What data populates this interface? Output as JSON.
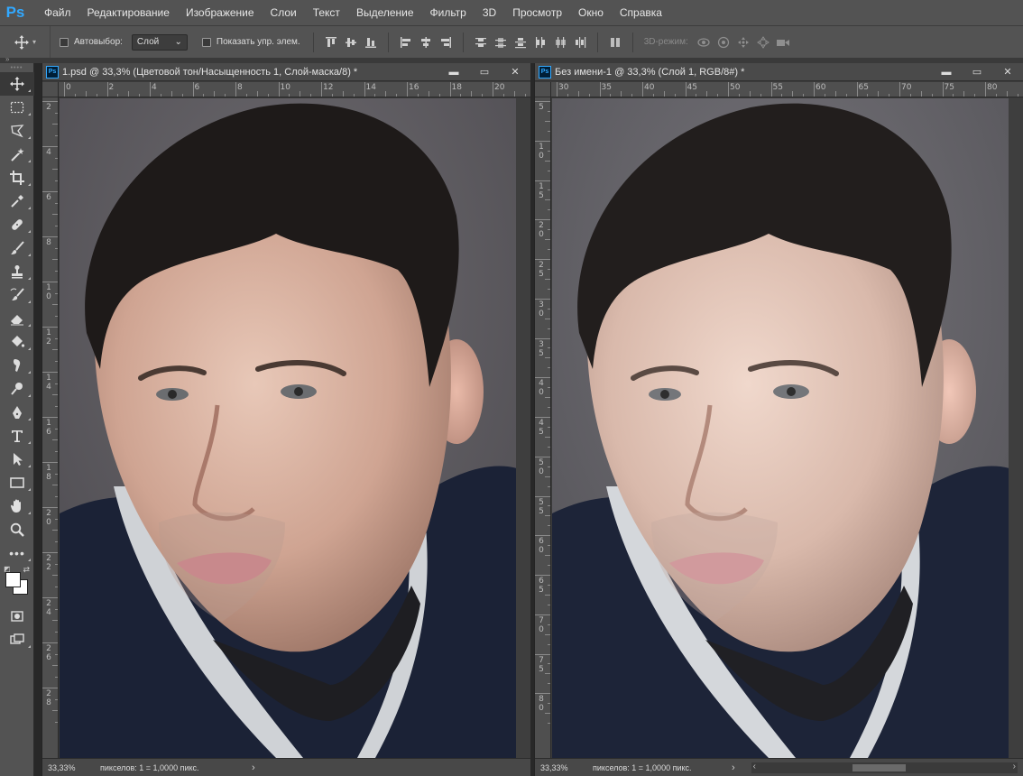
{
  "app": {
    "logo": "Ps",
    "menu": [
      "Файл",
      "Редактирование",
      "Изображение",
      "Слои",
      "Текст",
      "Выделение",
      "Фильтр",
      "3D",
      "Просмотр",
      "Окно",
      "Справка"
    ]
  },
  "options": {
    "autoselect_label": "Автовыбор:",
    "autoselect_value": "Слой",
    "show_controls_label": "Показать упр. элем.",
    "mode3d_label": "3D-режим:"
  },
  "tools": [
    {
      "name": "move-tool",
      "icon": "move-icon"
    },
    {
      "name": "marquee-tool",
      "icon": "marquee-icon"
    },
    {
      "name": "lasso-tool",
      "icon": "lasso-icon"
    },
    {
      "name": "magic-wand-tool",
      "icon": "magic-wand-icon"
    },
    {
      "name": "crop-tool",
      "icon": "crop-icon"
    },
    {
      "name": "eyedropper-tool",
      "icon": "eyedropper-icon"
    },
    {
      "name": "healing-brush-tool",
      "icon": "bandage-icon"
    },
    {
      "name": "brush-tool",
      "icon": "brush-icon"
    },
    {
      "name": "clone-stamp-tool",
      "icon": "stamp-icon"
    },
    {
      "name": "history-brush-tool",
      "icon": "history-brush-icon"
    },
    {
      "name": "eraser-tool",
      "icon": "eraser-icon"
    },
    {
      "name": "paint-bucket-tool",
      "icon": "bucket-icon"
    },
    {
      "name": "smudge-tool",
      "icon": "smudge-icon"
    },
    {
      "name": "dodge-tool",
      "icon": "dodge-icon"
    },
    {
      "name": "pen-tool",
      "icon": "pen-icon"
    },
    {
      "name": "type-tool",
      "icon": "type-icon"
    },
    {
      "name": "path-selection-tool",
      "icon": "arrow-icon"
    },
    {
      "name": "rectangle-tool",
      "icon": "rectangle-icon"
    },
    {
      "name": "hand-tool",
      "icon": "hand-icon"
    },
    {
      "name": "zoom-tool",
      "icon": "zoom-icon"
    },
    {
      "name": "more-tools",
      "icon": "ellipsis-icon"
    }
  ],
  "documents": {
    "left": {
      "title": "1.psd @ 33,3% (Цветовой тон/Насыщенность 1, Слой-маска/8) *",
      "ruler_top": [
        "0",
        "2",
        "4",
        "6",
        "8",
        "10",
        "12",
        "14",
        "16",
        "18",
        "20"
      ],
      "ruler_left": [
        "2",
        "4",
        "6",
        "8",
        "10",
        "12",
        "14",
        "16",
        "18",
        "20",
        "22",
        "24",
        "26",
        "28"
      ],
      "zoom": "33,33%",
      "info": "пикселов: 1 = 1,0000 пикс.",
      "adjusted": true
    },
    "right": {
      "title": "Без имени-1 @ 33,3% (Слой 1, RGB/8#) *",
      "ruler_top": [
        "30",
        "35",
        "40",
        "45",
        "50",
        "55",
        "60",
        "65",
        "70",
        "75",
        "80"
      ],
      "ruler_left": [
        "5",
        "1 0",
        "1 5",
        "2 0",
        "2 5",
        "3 0",
        "3 5",
        "4 0",
        "4 5",
        "5 0",
        "5 5",
        "6 0",
        "6 5",
        "7 0",
        "7 5",
        "8 0"
      ],
      "zoom": "33,33%",
      "info": "пикселов: 1 = 1,0000 пикс.",
      "adjusted": false
    }
  },
  "window_buttons": {
    "minimize": "▬",
    "restore": "▭",
    "close": "✕"
  },
  "colors": {
    "foreground": "#ffffff",
    "background": "#ffffff",
    "accent": "#31a8ff"
  }
}
